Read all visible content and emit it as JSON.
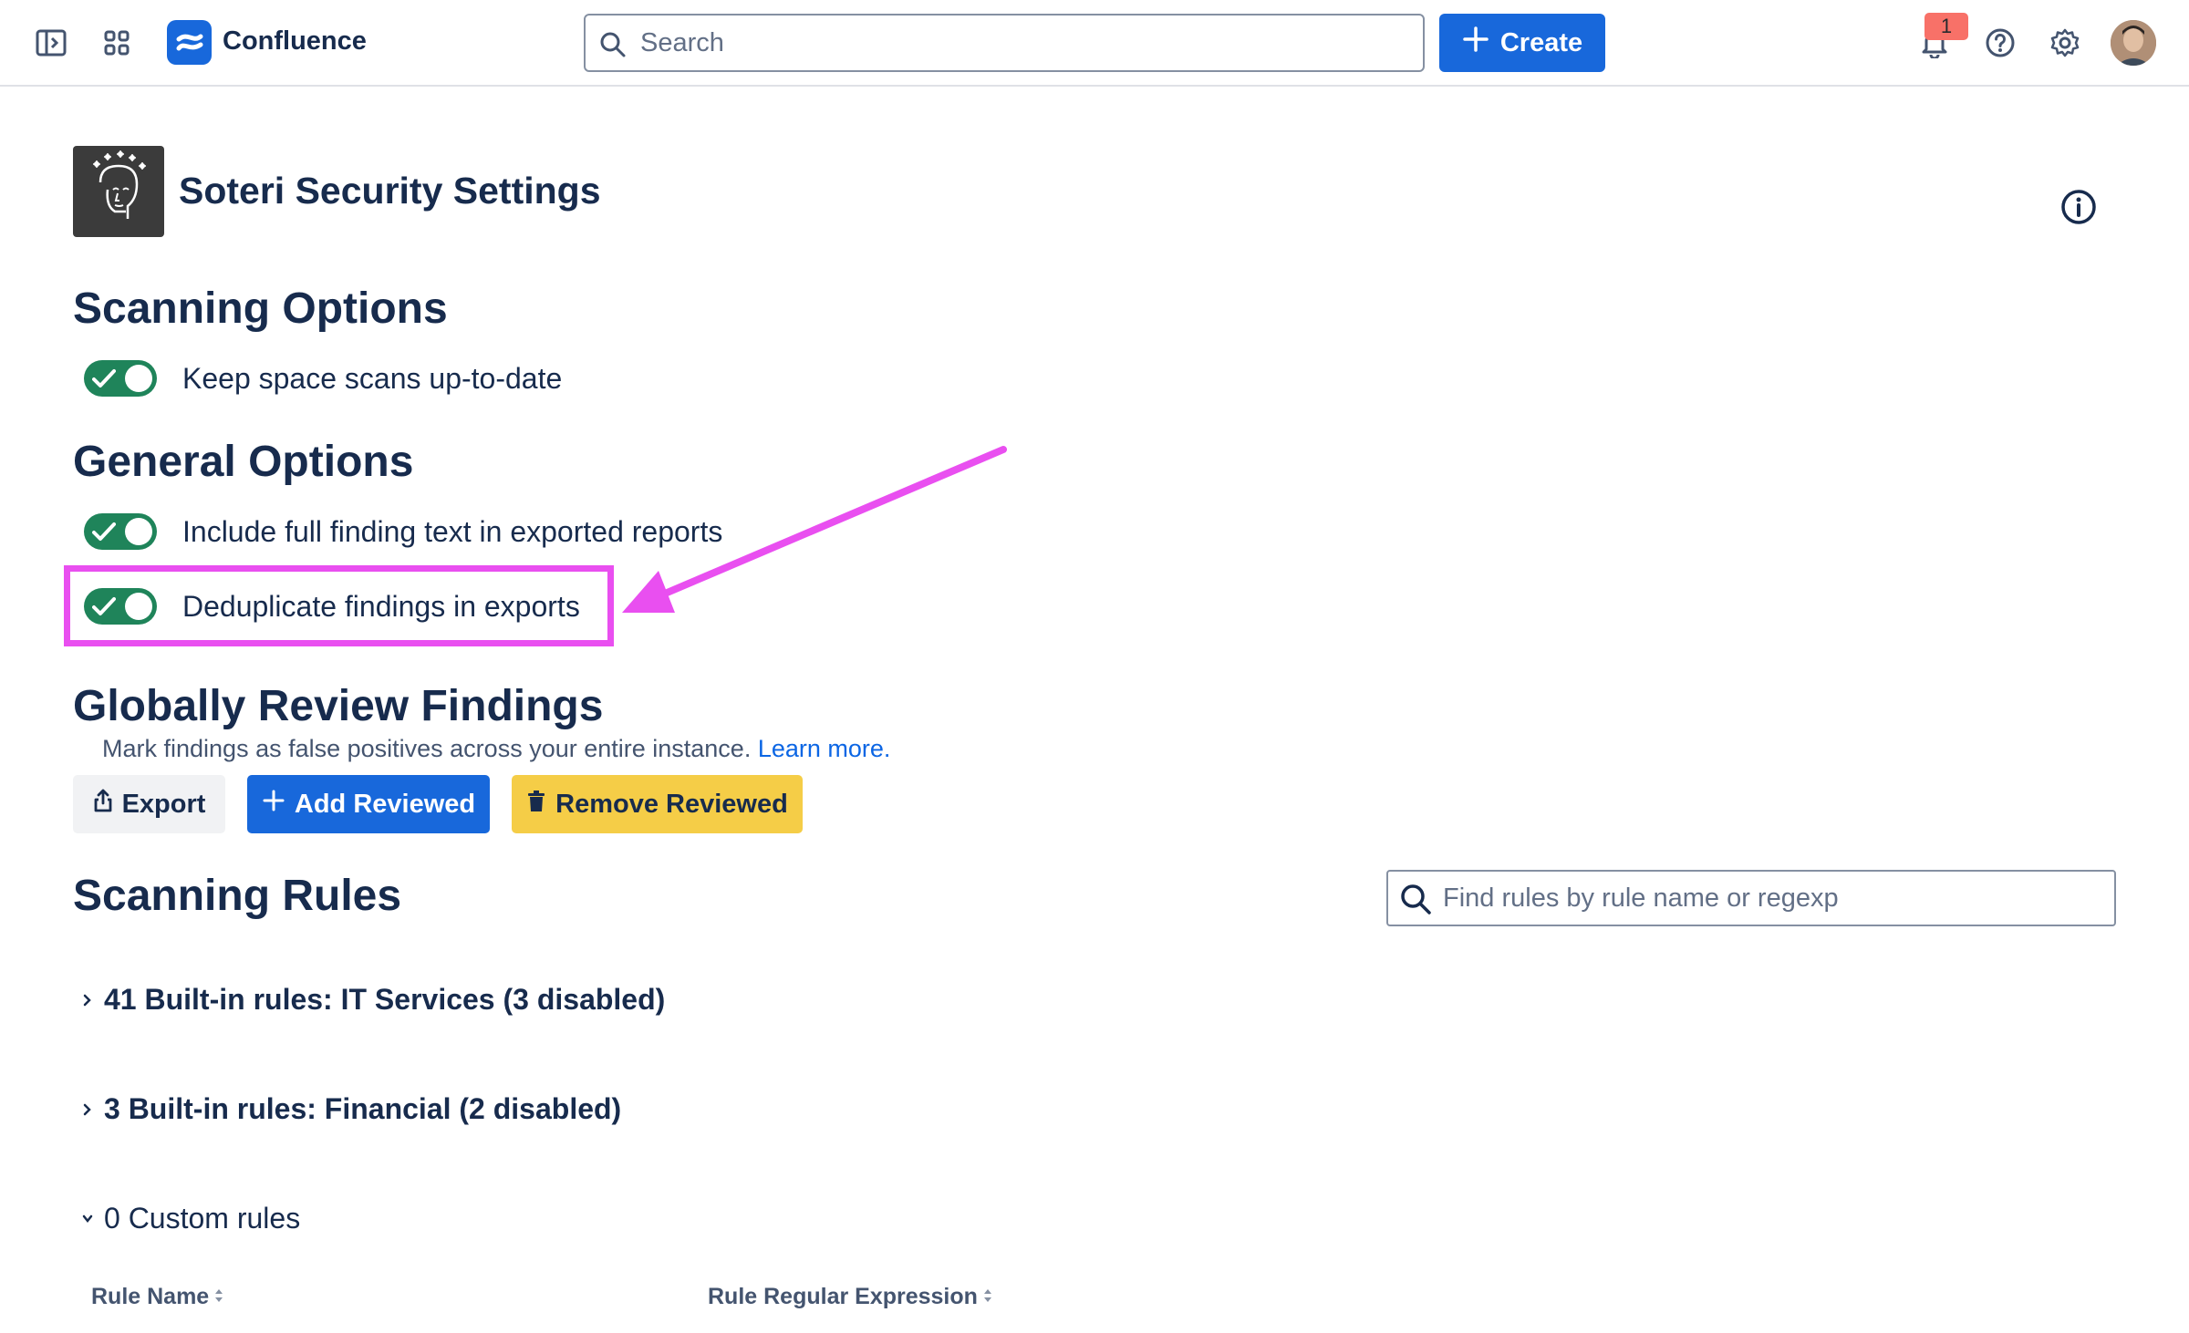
{
  "topbar": {
    "app_name": "Confluence",
    "search_placeholder": "Search",
    "create_label": "Create",
    "notification_count": "1",
    "icons": [
      "sidebar-toggle-icon",
      "app-switcher-icon",
      "confluence-logo-icon",
      "search-icon",
      "plus-icon",
      "bell-icon",
      "help-icon",
      "gear-icon"
    ],
    "brand_color": "#1868db"
  },
  "page": {
    "title": "Soteri Security Settings"
  },
  "sections": {
    "scanning_options": {
      "heading": "Scanning Options",
      "toggles": [
        {
          "label": "Keep space scans up-to-date",
          "on": true
        }
      ]
    },
    "general_options": {
      "heading": "General Options",
      "toggles": [
        {
          "label": "Include full finding text in exported reports",
          "on": true
        },
        {
          "label": "Deduplicate findings in exports",
          "on": true
        }
      ]
    },
    "review_findings": {
      "heading": "Globally Review Findings",
      "description": "Mark findings as false positives across your entire instance.",
      "learn_more": "Learn more.",
      "buttons": {
        "export": "Export",
        "add": "Add Reviewed",
        "remove": "Remove Reviewed"
      }
    },
    "scanning_rules": {
      "heading": "Scanning Rules",
      "search_placeholder": "Find rules by rule name or regexp",
      "groups": [
        {
          "label": "41 Built-in rules: IT Services (3 disabled)",
          "expanded": false
        },
        {
          "label": "3 Built-in rules: Financial (2 disabled)",
          "expanded": false
        },
        {
          "label": "0 Custom rules",
          "expanded": true
        }
      ],
      "columns": [
        "Rule Name",
        "Rule Regular Expression"
      ]
    }
  },
  "colors": {
    "toggle_on": "#1f845a",
    "annotation": "#e94ff0",
    "remove_button": "#f5cd47"
  }
}
